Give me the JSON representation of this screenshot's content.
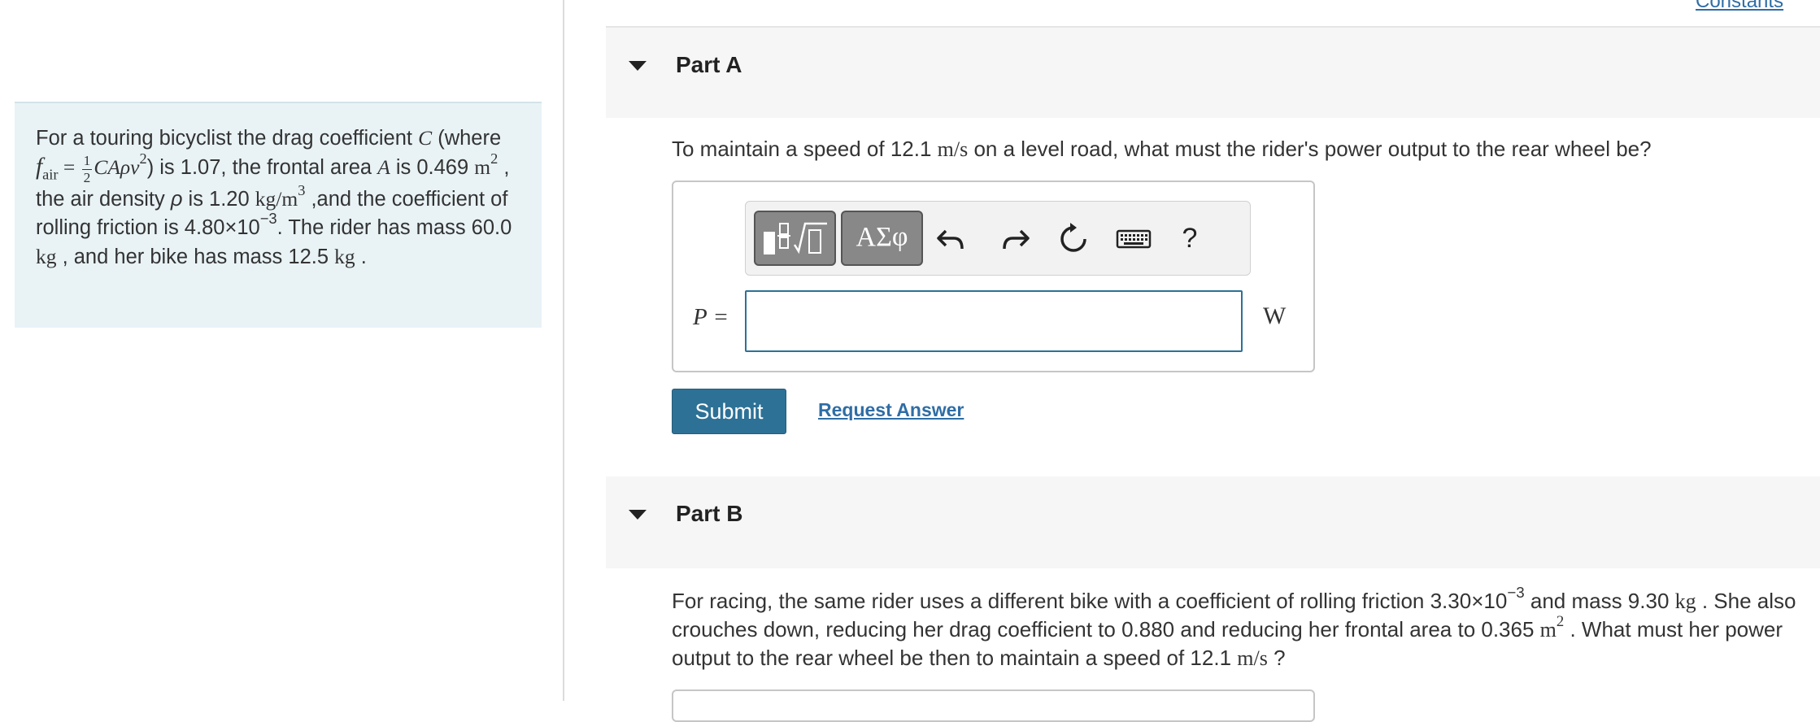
{
  "header": {
    "constants_link": "Constants"
  },
  "problem": {
    "p1": "For a touring bicyclist the drag coefficient ",
    "var_C": "C",
    "p2": " (where ",
    "f_base": "f",
    "f_sub": "air",
    "eq": " = ",
    "frac_num": "1",
    "frac_den": "2",
    "formula_body": "CAρv",
    "formula_exp": "2",
    "p3": ") is 1.07, the frontal area ",
    "var_A": "A",
    "p4": " is 0.469 ",
    "unit_m": "m",
    "unit_m_exp": "2",
    "p5": " , the air density ",
    "var_rho": "ρ",
    "p6": " is 1.20 ",
    "unit_density": "kg/m",
    "unit_density_exp": "3",
    "p7": " ,and the coefficient of rolling friction is 4.80×10",
    "exp_friction": "−3",
    "p8": ". The rider has mass 60.0 ",
    "unit_kg1": "kg",
    "p9": " , and her bike has mass 12.5 ",
    "unit_kg2": "kg",
    "p10": " ."
  },
  "partA": {
    "title": "Part A",
    "q1": "To maintain a speed of 12.1 ",
    "q_unit": "m/s",
    "q2": " on a level road, what must the rider's power output to the rear wheel be?",
    "var_label": "P =",
    "input_value": "",
    "unit": "W",
    "toolbar": {
      "symbols_label": "ΑΣφ",
      "undo_icon": "undo-icon",
      "redo_icon": "redo-icon",
      "reset_icon": "reset-icon",
      "keyboard_icon": "keyboard-icon",
      "help_label": "?"
    },
    "submit_label": "Submit",
    "request_answer_label": "Request Answer"
  },
  "partB": {
    "title": "Part B",
    "q1": "For racing, the same rider uses a different bike with a coefficient of rolling friction 3.30×10",
    "exp1": "−3",
    "q2": " and mass 9.30 ",
    "unit_kg": "kg",
    "q3": " . She also crouches down, reducing her drag coefficient to 0.880 and reducing her frontal area to 0.365 ",
    "unit_m": "m",
    "unit_m_exp": "2",
    "q4": " . What must her power output to the rear wheel be then to maintain a speed of 12.1 ",
    "unit_speed": "m/s",
    "q5": " ?"
  },
  "colors": {
    "accent": "#2d7196",
    "link": "#2f6da5",
    "problem_bg": "#e9f3f6",
    "part_header_bg": "#f6f6f6"
  }
}
